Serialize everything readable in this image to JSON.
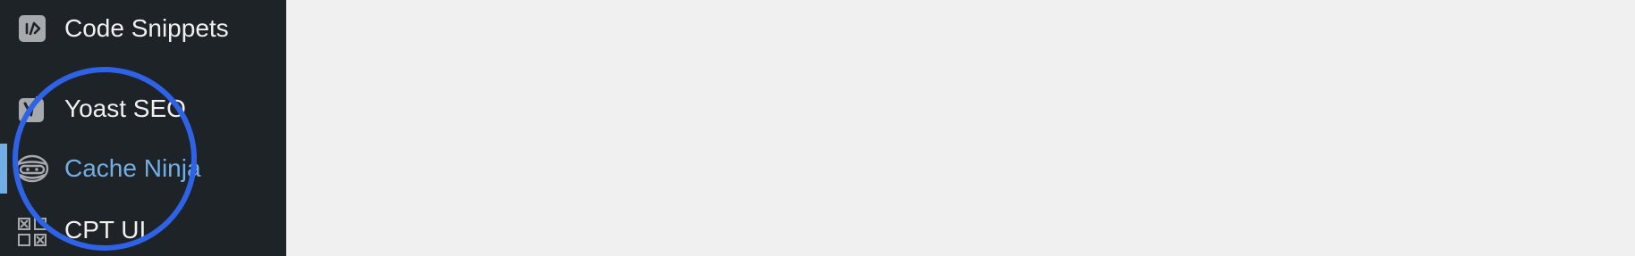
{
  "sidebar": {
    "items": [
      {
        "label": "Code Snippets",
        "icon": "code-snippets-icon",
        "current": false
      },
      {
        "label": "Yoast SEO",
        "icon": "yoast-icon",
        "current": false
      },
      {
        "label": "Cache Ninja",
        "icon": "ninja-icon",
        "current": true
      },
      {
        "label": "CPT UI",
        "icon": "cpt-ui-icon",
        "current": false
      }
    ]
  },
  "colors": {
    "sidebar_bg": "#1d2327",
    "content_bg": "#f0f0f1",
    "menu_text": "#f0f0f1",
    "current_text": "#72aee6",
    "annotation_circle": "#2f63e7"
  }
}
